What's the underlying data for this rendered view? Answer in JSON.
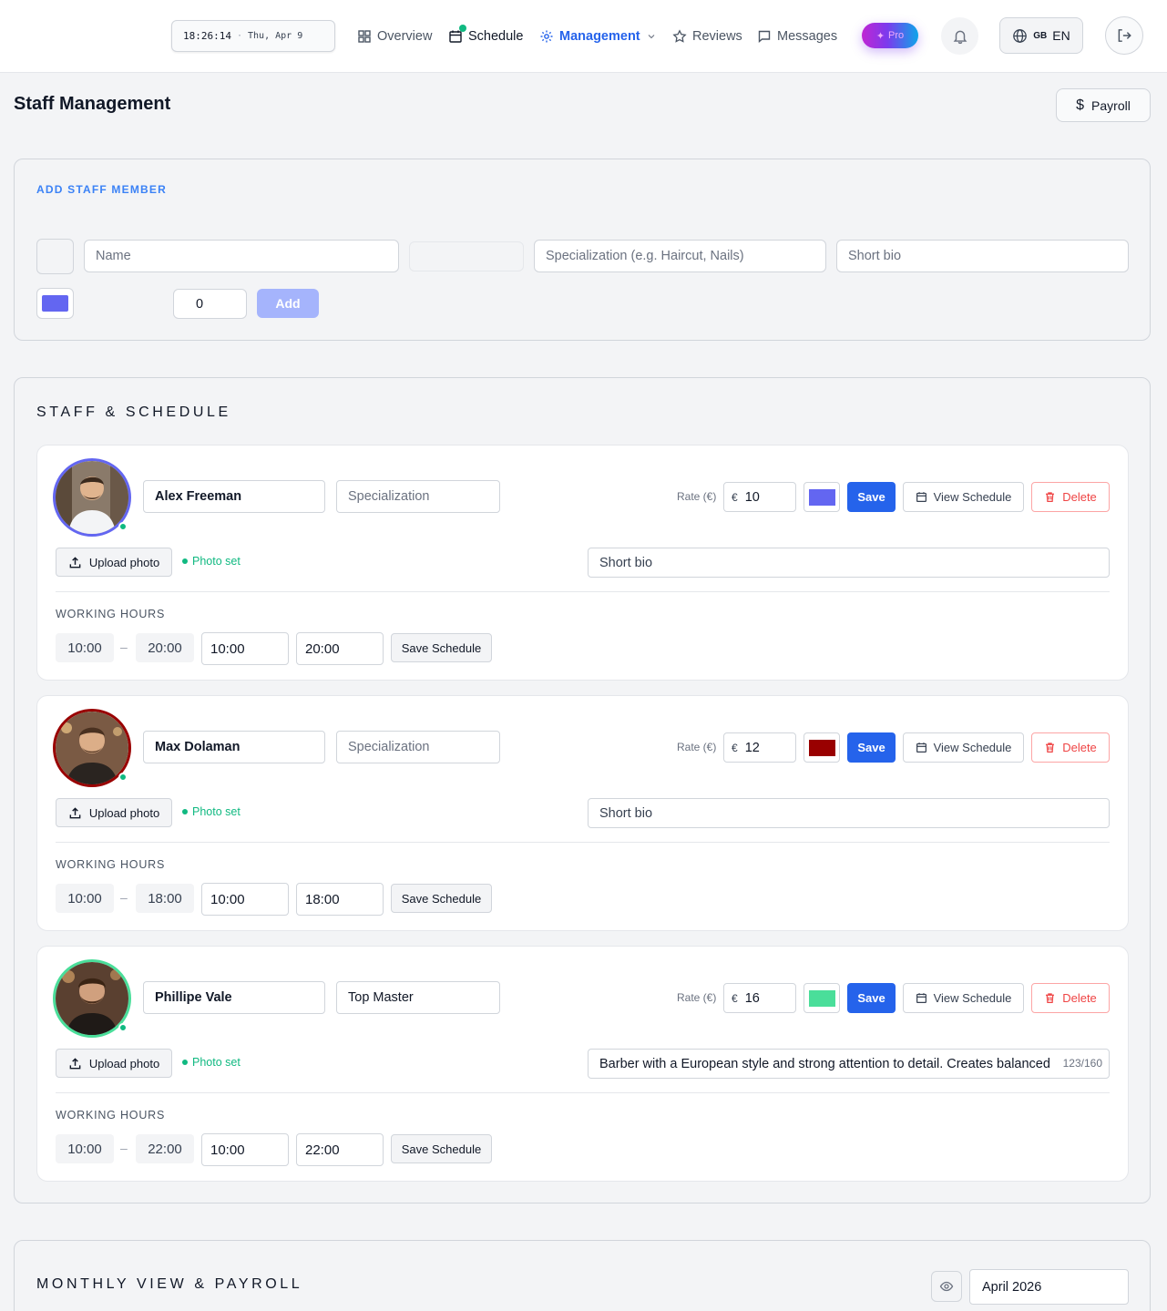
{
  "topbar": {
    "clock_time": "18:26:14",
    "clock_sep": "·",
    "clock_date": "Thu, Apr 9",
    "nav": {
      "overview": "Overview",
      "schedule": "Schedule",
      "management": "Management",
      "reviews": "Reviews",
      "messages": "Messages"
    },
    "pro_label": "Pro",
    "lang_flag": "GB",
    "lang_code": "EN",
    "accent_color": "#2563eb"
  },
  "page": {
    "title": "Staff Management",
    "payroll_label": "Payroll"
  },
  "add_staff": {
    "title": "ADD STAFF MEMBER",
    "name_placeholder": "Name",
    "specialization_placeholder": "Specialization (e.g. Haircut, Nails)",
    "bio_placeholder": "Short bio",
    "rate_value": "0",
    "color": "#6366f1",
    "add_label": "Add"
  },
  "staff_section": {
    "title": "STAFF & SCHEDULE",
    "rate_label": "Rate (€)",
    "currency": "€",
    "save_label": "Save",
    "view_schedule_label": "View Schedule",
    "delete_label": "Delete",
    "upload_label": "Upload photo",
    "photo_set_label": "Photo set",
    "working_hours_label": "WORKING HOURS",
    "save_schedule_label": "Save Schedule",
    "specialization_placeholder": "Specialization",
    "bio_placeholder": "Short bio",
    "dash": "–"
  },
  "staff": [
    {
      "name": "Alex Freeman",
      "specialization": "",
      "rate": "10",
      "color": "#6366f1",
      "bio": "",
      "bio_count": "",
      "start": "10:00",
      "end": "20:00"
    },
    {
      "name": "Max Dolaman",
      "specialization": "",
      "rate": "12",
      "color": "#990000",
      "bio": "",
      "bio_count": "",
      "start": "10:00",
      "end": "18:00"
    },
    {
      "name": "Phillipe Vale",
      "specialization": "Top Master",
      "rate": "16",
      "color": "#4ade9a",
      "bio": "Barber with a European style and strong attention to detail. Creates balanced",
      "bio_count": "123/160",
      "start": "10:00",
      "end": "22:00"
    }
  ],
  "monthly": {
    "title": "MONTHLY VIEW & PAYROLL",
    "month": "April 2026"
  }
}
